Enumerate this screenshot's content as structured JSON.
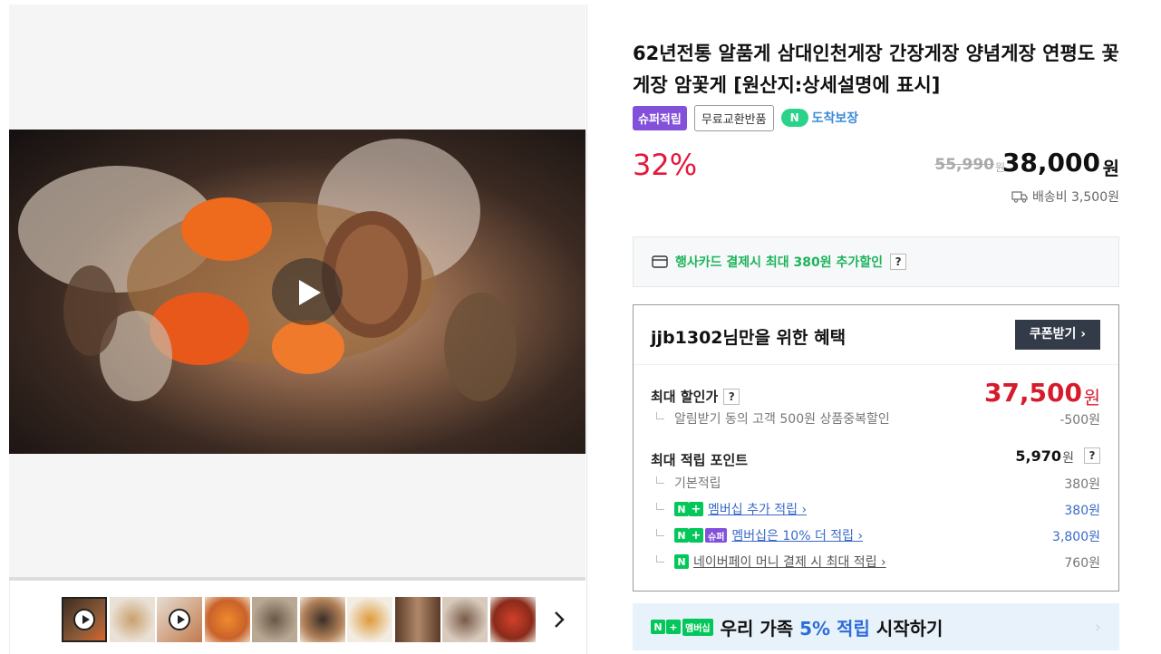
{
  "product": {
    "title": "62년전통 알품게 삼대인천게장 간장게장 양념게장 연평도 꽃게장 암꽃게 [원산지:상세설명에 표시]",
    "badges": {
      "super": "슈퍼적립",
      "free_return": "무료교환반품",
      "arrive_n": "N",
      "arrive": "도착보장"
    },
    "discount_rate": "32%",
    "original_price": "55,990",
    "price": "38,000",
    "currency": "원",
    "shipping": "배송비 3,500원"
  },
  "card_promo": {
    "text": "행사카드 결제시 최대 380원 추가할인",
    "help": "?"
  },
  "benefit": {
    "title": "jjb1302님만을 위한 혜택",
    "coupon_button": "쿠폰받기 ›",
    "max_discount": {
      "label": "최대 할인가",
      "help": "?",
      "amount": "37,500",
      "currency": "원",
      "sub_label": "알림받기 동의 고객 500원 상품중복할인",
      "sub_amount": "-500원"
    },
    "max_points": {
      "label": "최대 적립 포인트",
      "amount": "5,970",
      "currency": "원",
      "help": "?",
      "items": [
        {
          "label": "기본적립",
          "amount": "380원"
        },
        {
          "label": "멤버십 추가 적립 ›",
          "amount": "380원"
        },
        {
          "label": "멤버십은 10% 더 적립 ›",
          "amount": "3,800원"
        },
        {
          "label": "네이버페이 머니 결제 시 최대 적립 ›",
          "amount": "760원"
        }
      ],
      "tags": {
        "n": "N",
        "plus": "+",
        "super": "슈퍼",
        "npay": "N"
      }
    }
  },
  "banner": {
    "tag_n": "N",
    "tag_plus": "+",
    "tag_member": "멤버십",
    "text_pre": "우리 가족 ",
    "text_hl": "5% 적립",
    "text_post": " 시작하기",
    "chevron": "›"
  },
  "icons": [
    "play-icon",
    "card-icon",
    "truck-icon",
    "chevron-right-icon"
  ],
  "colors": {
    "discount": "#e4183c",
    "accent_green": "#03c75a",
    "super_purple": "#8250d9",
    "link_blue": "#3a6ac8"
  }
}
